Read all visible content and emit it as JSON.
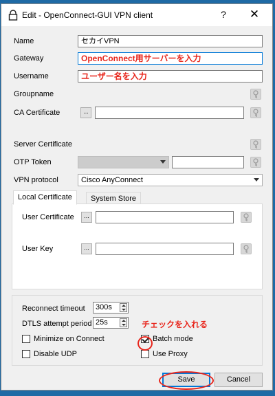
{
  "window": {
    "title": "Edit - OpenConnect-GUI VPN client",
    "help_glyph": "?",
    "close_glyph": "✕"
  },
  "form": {
    "name_label": "Name",
    "name_value": "セカイVPN",
    "gateway_label": "Gateway",
    "gateway_value": "OpenConnect用サーバーを入力",
    "username_label": "Username",
    "username_value": "ユーザー名を入力",
    "groupname_label": "Groupname",
    "ca_label": "CA Certificate",
    "browse_label": "...",
    "server_cert_label": "Server Certificate",
    "otp_label": "OTP Token",
    "vpn_protocol_label": "VPN protocol",
    "vpn_protocol_value": "Cisco AnyConnect"
  },
  "tabs": {
    "items": [
      "Local Certificate",
      "System Store"
    ],
    "user_cert_label": "User Certificate",
    "user_key_label": "User Key"
  },
  "options": {
    "reconnect_label": "Reconnect timeout",
    "reconnect_value": "300s",
    "dtls_label": "DTLS attempt period",
    "dtls_value": "25s",
    "minimize_label": "Minimize on Connect",
    "minimize_checked": false,
    "disable_udp_label": "Disable UDP",
    "disable_udp_checked": false,
    "batch_label": "Batch mode",
    "batch_checked": true,
    "proxy_label": "Use Proxy",
    "proxy_checked": false
  },
  "annotations": {
    "check_note": "チェックを入れる"
  },
  "buttons": {
    "save": "Save",
    "cancel": "Cancel"
  },
  "colors": {
    "annotation_red": "#e8251b",
    "focus_blue": "#0078d7",
    "desktop_blue": "#1f6aa5"
  },
  "icons": [
    "lock-icon",
    "key-icon"
  ]
}
